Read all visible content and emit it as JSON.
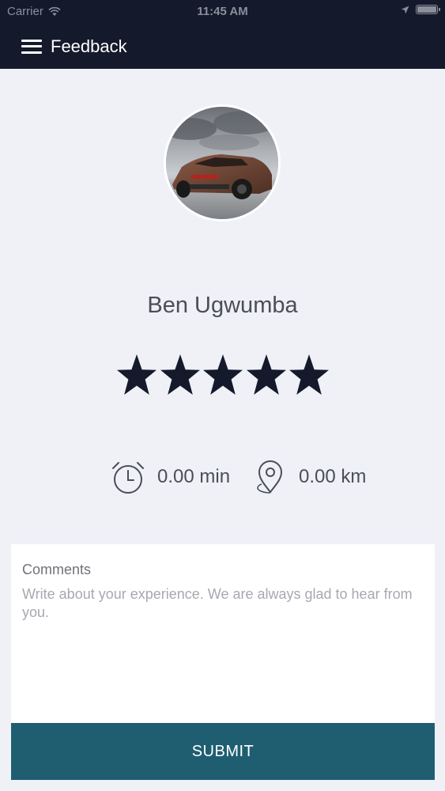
{
  "status_bar": {
    "carrier": "Carrier",
    "time": "11:45 AM"
  },
  "header": {
    "title": "Feedback",
    "menu_icon": "hamburger-menu-icon",
    "background": "#141a2b"
  },
  "driver": {
    "name": "Ben Ugwumba",
    "avatar": "car-photo-avatar"
  },
  "rating": {
    "value": 5,
    "max": 5,
    "star_color": "#141a2b"
  },
  "trip": {
    "duration": "0.00 min",
    "duration_icon": "alarm-clock-icon",
    "distance": "0.00 km",
    "distance_icon": "map-pin-icon"
  },
  "comments": {
    "label": "Comments",
    "placeholder": "Write about your experience. We are always glad to hear from you.",
    "value": ""
  },
  "submit": {
    "label": "SUBMIT",
    "color": "#1f5e71"
  }
}
